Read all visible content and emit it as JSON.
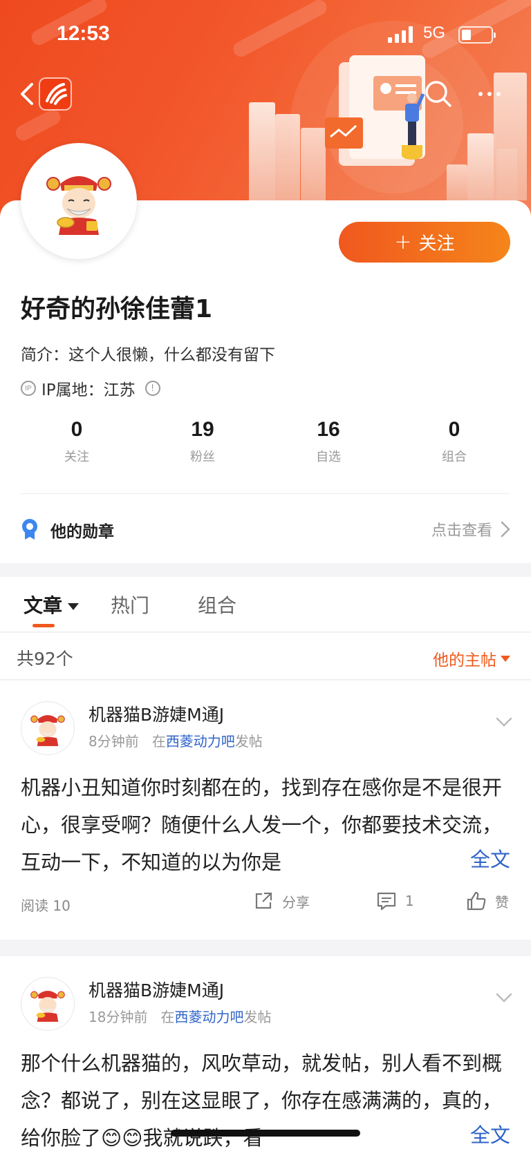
{
  "status": {
    "time": "12:53",
    "network": "5G"
  },
  "profile": {
    "nickname": "好奇的孙徐佳蕾1",
    "bio": "简介：这个人很懒，什么都没有留下",
    "ip": "IP属地：江苏",
    "follow_label": "关注",
    "follow_plus": "+",
    "stats": [
      {
        "value": "0",
        "label": "关注"
      },
      {
        "value": "19",
        "label": "粉丝"
      },
      {
        "value": "16",
        "label": "自选"
      },
      {
        "value": "0",
        "label": "组合"
      }
    ],
    "medal_label": "他的勋章",
    "medal_action": "点击查看"
  },
  "tabs": [
    {
      "label": "文章",
      "active": true
    },
    {
      "label": "热门",
      "active": false
    },
    {
      "label": "组合",
      "active": false
    }
  ],
  "list": {
    "count": "共92个",
    "filter": "他的主帖"
  },
  "posts": [
    {
      "author": "机器猫B游婕M通J",
      "time": "8分钟前",
      "prefix": "在",
      "forum": "西菱动力吧",
      "suffix": "发帖",
      "text": "机器小丑知道你时刻都在的，找到存在感你是不是很开心，很享受啊？随便什么人发一个，你都要技术交流，互动一下，不知道的以为你是",
      "fulltext": "全文",
      "reads": "阅读 10",
      "share": "分享",
      "comments": "1",
      "like": "赞"
    },
    {
      "author": "机器猫B游婕M通J",
      "time": "18分钟前",
      "prefix": "在",
      "forum": "西菱动力吧",
      "suffix": "发帖",
      "text": "那个什么机器猫的，风吹草动，就发帖，别人看不到概念？都说了，别在这显眼了，你存在感满满的，真的，给你脸了😊😊我就说跌，看",
      "fulltext": "全文"
    }
  ],
  "colors": {
    "accent": "#f0581f",
    "link": "#2f63c9",
    "banner": "#ef4a1f"
  }
}
